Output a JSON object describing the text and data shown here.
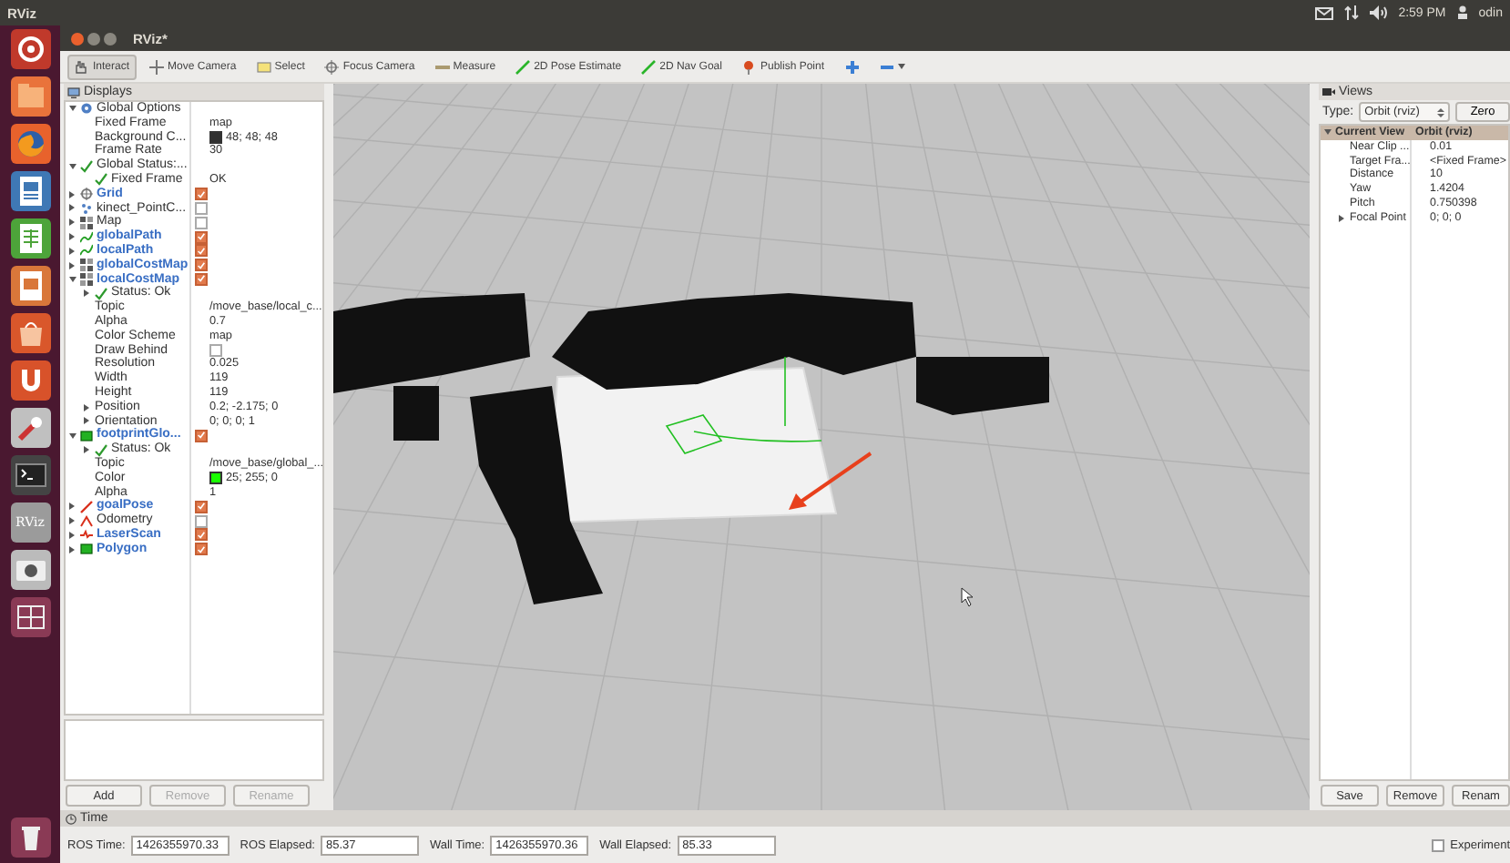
{
  "top_bar": {
    "title": "RViz",
    "clock": "2:59 PM",
    "user": "odin"
  },
  "launcher": [
    {
      "kind": "dash"
    },
    {
      "kind": "files"
    },
    {
      "kind": "browser"
    },
    {
      "kind": "writer"
    },
    {
      "kind": "calc"
    },
    {
      "kind": "impress"
    },
    {
      "kind": "store"
    },
    {
      "kind": "one"
    },
    {
      "kind": "settings"
    },
    {
      "kind": "terminal"
    },
    {
      "kind": "app",
      "label": "RViz"
    },
    {
      "kind": "camera"
    },
    {
      "kind": "workspaces"
    },
    {
      "kind": "trash"
    }
  ],
  "window": {
    "title": "RViz*"
  },
  "toolbar": [
    {
      "kind": "interact",
      "label": "Interact",
      "selected": true
    },
    {
      "kind": "move",
      "label": "Move Camera",
      "selected": false
    },
    {
      "kind": "select",
      "label": "Select",
      "selected": false
    },
    {
      "kind": "focus",
      "label": "Focus Camera",
      "selected": false
    },
    {
      "kind": "measure",
      "label": "Measure",
      "selected": false
    },
    {
      "kind": "pose",
      "label": "2D Pose Estimate",
      "selected": false
    },
    {
      "kind": "goal",
      "label": "2D Nav Goal",
      "selected": false
    },
    {
      "kind": "publish",
      "label": "Publish Point",
      "selected": false
    },
    {
      "kind": "add",
      "selected": false
    },
    {
      "kind": "remove",
      "selected": false
    }
  ],
  "displays": {
    "title": "Displays",
    "tree": [
      {
        "kind": "options",
        "label": "Global Options",
        "expanded": true,
        "children": [
          {
            "kind": "property",
            "label": "Fixed Frame",
            "value": "map"
          },
          {
            "kind": "property",
            "label": "Background C...",
            "value": "48; 48; 48",
            "color": "#303030"
          },
          {
            "kind": "property",
            "label": "Frame Rate",
            "value": "30"
          }
        ]
      },
      {
        "kind": "status",
        "label": "Global Status:...",
        "expanded": true,
        "children": [
          {
            "kind": "status",
            "label": "Fixed Frame",
            "value": "OK"
          }
        ]
      },
      {
        "kind": "grid",
        "label": "Grid",
        "expanded": false,
        "checked": true
      },
      {
        "kind": "pointcloud",
        "label": "kinect_PointC...",
        "expanded": false,
        "checked": false
      },
      {
        "kind": "map",
        "label": "Map",
        "expanded": false,
        "checked": false
      },
      {
        "kind": "path",
        "label": "globalPath",
        "expanded": false,
        "checked": true
      },
      {
        "kind": "path",
        "label": "localPath",
        "expanded": false,
        "checked": true
      },
      {
        "kind": "map",
        "label": "globalCostMap",
        "expanded": false,
        "checked": true
      },
      {
        "kind": "map",
        "label": "localCostMap",
        "expanded": true,
        "checked": true,
        "children": [
          {
            "kind": "status",
            "label": "Status: Ok",
            "expanded": false
          },
          {
            "kind": "property",
            "label": "Topic",
            "value": "/move_base/local_c..."
          },
          {
            "kind": "property",
            "label": "Alpha",
            "value": "0.7"
          },
          {
            "kind": "property",
            "label": "Color Scheme",
            "value": "map"
          },
          {
            "kind": "property",
            "label": "Draw Behind",
            "checked": false
          },
          {
            "kind": "property",
            "label": "Resolution",
            "value": "0.025"
          },
          {
            "kind": "property",
            "label": "Width",
            "value": "119"
          },
          {
            "kind": "property",
            "label": "Height",
            "value": "119"
          },
          {
            "kind": "property",
            "label": "Position",
            "value": "0.2; -2.175; 0",
            "expanded": false
          },
          {
            "kind": "property",
            "label": "Orientation",
            "value": "0; 0; 0; 1",
            "expanded": false
          }
        ]
      },
      {
        "kind": "polygon",
        "label": "footprintGlo...",
        "expanded": true,
        "checked": true,
        "children": [
          {
            "kind": "status",
            "label": "Status: Ok",
            "expanded": false
          },
          {
            "kind": "property",
            "label": "Topic",
            "value": "/move_base/global_..."
          },
          {
            "kind": "property",
            "label": "Color",
            "value": "25; 255; 0",
            "color": "#19ff00"
          },
          {
            "kind": "property",
            "label": "Alpha",
            "value": "1"
          }
        ]
      },
      {
        "kind": "pose",
        "label": "goalPose",
        "expanded": false,
        "checked": true
      },
      {
        "kind": "odometry",
        "label": "Odometry",
        "expanded": false,
        "checked": false
      },
      {
        "kind": "laserscan",
        "label": "LaserScan",
        "expanded": false,
        "checked": true
      },
      {
        "kind": "polygon",
        "label": "Polygon",
        "expanded": false,
        "checked": true
      }
    ],
    "buttons": [
      {
        "label": "Add",
        "disabled": false
      },
      {
        "label": "Remove",
        "disabled": true
      },
      {
        "label": "Rename",
        "disabled": true
      }
    ]
  },
  "views": {
    "title": "Views",
    "type_label": "Type:",
    "type_value": "Orbit (rviz)",
    "zero_button": "Zero",
    "tree": [
      {
        "kind": "category",
        "label": "Current View",
        "value": "Orbit (rviz)",
        "expanded": true,
        "children": [
          {
            "label": "Near Clip ...",
            "value": "0.01"
          },
          {
            "label": "Target Fra...",
            "value": "<Fixed Frame>"
          },
          {
            "label": "Distance",
            "value": "10"
          },
          {
            "label": "Yaw",
            "value": "1.4204"
          },
          {
            "label": "Pitch",
            "value": "0.750398"
          },
          {
            "label": "Focal Point",
            "value": "0; 0; 0",
            "expanded": false
          }
        ]
      }
    ],
    "buttons": [
      {
        "label": "Save",
        "disabled": false
      },
      {
        "label": "Remove",
        "disabled": false
      },
      {
        "label": "Renam",
        "disabled": false
      }
    ]
  },
  "time": {
    "title": "Time",
    "fields": [
      {
        "label": "ROS Time:",
        "value": "1426355970.33"
      },
      {
        "label": "ROS Elapsed:",
        "value": "85.37"
      },
      {
        "label": "Wall Time:",
        "value": "1426355970.36"
      },
      {
        "label": "Wall Elapsed:",
        "value": "85.33"
      }
    ],
    "experimental": {
      "label": "Experiment",
      "checked": false
    }
  }
}
